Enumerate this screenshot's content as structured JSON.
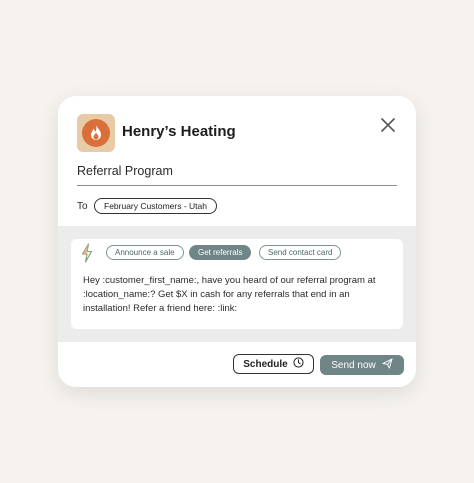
{
  "header": {
    "brand_name": "Henry’s Heating",
    "logo_icon": "flame-icon",
    "close_icon": "close-icon"
  },
  "form": {
    "subject": "Referral Program",
    "to_label": "To",
    "recipient_chip": "February Customers - Utah"
  },
  "compose": {
    "assist_icon": "lightning-bolt-icon",
    "suggestions": [
      {
        "label": "Announce a sale",
        "active": false
      },
      {
        "label": "Get referrals",
        "active": true
      },
      {
        "label": "Send contact card",
        "active": false
      }
    ],
    "message": "Hey :customer_first_name:, have you heard of our referral program at :location_name:? Get $X in cash for any referrals that end in an installation! Refer a friend here: :link:"
  },
  "footer": {
    "schedule_label": "Schedule",
    "schedule_icon": "clock-icon",
    "send_label": "Send now",
    "send_icon": "paper-plane-icon"
  },
  "colors": {
    "accent": "#6f8586",
    "logo_bg": "#e7cba7",
    "logo_flame": "#d97039",
    "page_bg": "#f6f3ee"
  }
}
